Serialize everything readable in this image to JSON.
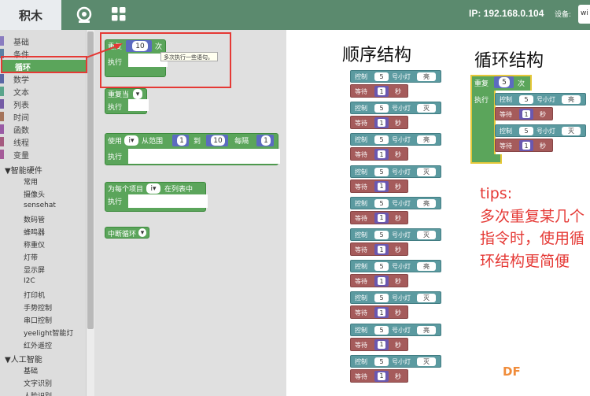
{
  "app": {
    "active_tab": "积木",
    "ip": "IP: 192.168.0.104",
    "device_label": "设备:",
    "device_value": "wi"
  },
  "sidebar": {
    "categories": [
      {
        "label": "基础",
        "color": "#8a7cc0"
      },
      {
        "label": "条件",
        "color": "#5b80a5"
      },
      {
        "label": "循环",
        "color": "#5ba55b"
      },
      {
        "label": "数学",
        "color": "#5b67a5"
      },
      {
        "label": "文本",
        "color": "#5ba58c"
      },
      {
        "label": "列表",
        "color": "#745ba5"
      },
      {
        "label": "时间",
        "color": "#a5745b"
      },
      {
        "label": "函数",
        "color": "#995ba5"
      },
      {
        "label": "线程",
        "color": "#a55b80"
      },
      {
        "label": "变量",
        "color": "#a55b99"
      }
    ],
    "hw_group": "▼智能硬件",
    "hw_items": [
      "常用",
      "摄像头",
      "sensehat",
      "数码管",
      "蜂鸣器",
      "称重仪",
      "灯带",
      "显示屏",
      "I2C",
      "打印机",
      "手势控制",
      "串口控制",
      "yeelight智能灯",
      "红外遥控"
    ],
    "ai_group": "▼人工智能",
    "ai_items": [
      "基础",
      "文字识别",
      "人脸识别"
    ]
  },
  "flyout": {
    "repeat": {
      "label": "重复",
      "times": "10",
      "unit": "次",
      "do": "执行",
      "tooltip": "多次执行一些语句。"
    },
    "repeat_while": {
      "label": "重复当",
      "do": "执行"
    },
    "for_range": {
      "label": "使用",
      "var": "i",
      "from": "从范围",
      "start": "1",
      "to": "到",
      "end": "10",
      "step_label": "每隔",
      "step": "1",
      "do": "执行"
    },
    "for_each": {
      "label": "为每个项目",
      "var": "i",
      "in": "在列表中",
      "do": "执行"
    },
    "break": {
      "label": "中断循环"
    }
  },
  "diagram": {
    "seq_title": "顺序结构",
    "loop_title": "循环结构",
    "ctrl": {
      "label": "控制",
      "num": "5",
      "lamp": "号小灯"
    },
    "wait": {
      "label": "等待",
      "num": "1",
      "unit": "秒"
    },
    "seq_states": [
      "亮",
      "灭",
      "亮",
      "灭",
      "亮",
      "灭",
      "亮",
      "灭",
      "亮",
      "灭"
    ],
    "loop": {
      "label": "重复",
      "times": "5",
      "unit": "次",
      "do": "执行",
      "states": [
        "亮",
        "灭"
      ]
    }
  },
  "tips": {
    "title": "tips:",
    "body": "多次重复某几个指令时，使用循环结构更简便"
  },
  "watermark": "DF"
}
